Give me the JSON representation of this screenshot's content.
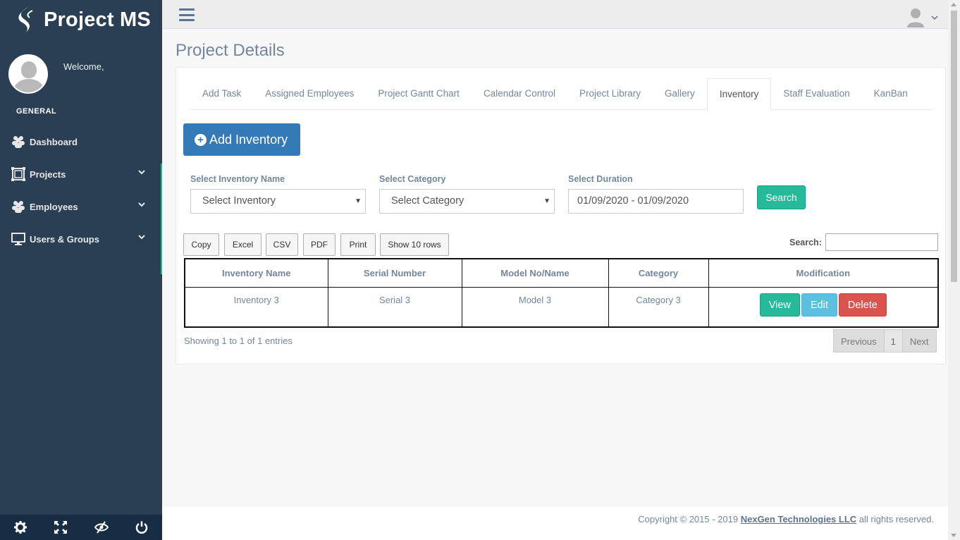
{
  "app": {
    "brand": "Project MS",
    "welcome": "Welcome,"
  },
  "sidebar": {
    "section": "GENERAL",
    "items": [
      {
        "label": "Dashboard",
        "icon": "users-icon"
      },
      {
        "label": "Projects",
        "icon": "projects-icon"
      },
      {
        "label": "Employees",
        "icon": "users-icon"
      },
      {
        "label": "Users & Groups",
        "icon": "desktop-icon"
      }
    ],
    "footer_icons": [
      "gear-icon",
      "fullscreen-icon",
      "eye-slash-icon",
      "power-icon"
    ]
  },
  "page": {
    "title": "Project Details"
  },
  "tabs": [
    "Add Task",
    "Assigned Employees",
    "Project Gantt Chart",
    "Calendar Control",
    "Project Library",
    "Gallery",
    "Inventory",
    "Staff Evaluation",
    "KanBan"
  ],
  "active_tab": "Inventory",
  "add_button": "Add Inventory",
  "filters": {
    "inventory_label": "Select Inventory Name",
    "inventory_value": "Select Inventory",
    "category_label": "Select Category",
    "category_value": "Select Category",
    "duration_label": "Select Duration",
    "duration_value": "01/09/2020 - 01/09/2020",
    "search_button": "Search"
  },
  "export_buttons": [
    "Copy",
    "Excel",
    "CSV",
    "PDF",
    "Print",
    "Show 10 rows"
  ],
  "table_search_label": "Search:",
  "table": {
    "headers": [
      "Inventory Name",
      "Serial Number",
      "Model No/Name",
      "Category",
      "Modification"
    ],
    "rows": [
      {
        "name": "Inventory 3",
        "serial": "Serial 3",
        "model": "Model 3",
        "category": "Category 3"
      }
    ],
    "actions": {
      "view": "View",
      "edit": "Edit",
      "delete": "Delete"
    }
  },
  "info": "Showing 1 to 1 of 1 entries",
  "pager": {
    "prev": "Previous",
    "page": "1",
    "next": "Next"
  },
  "footer": {
    "text": "Copyright © 2015 - 2019 ",
    "company": "NexGen Technologies LLC",
    "suffix": " all rights reserved."
  },
  "colors": {
    "sidebar": "#2A3F54",
    "primary": "#337AB7",
    "success": "#26B99A",
    "info": "#5BC0DE",
    "danger": "#D9534F"
  }
}
